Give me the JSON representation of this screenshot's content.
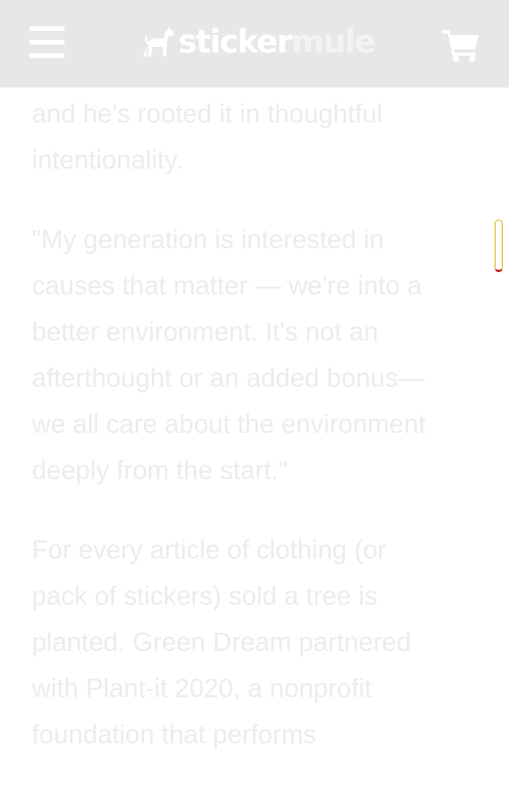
{
  "header": {
    "menu_icon": "hamburger-menu-icon",
    "logo_icon": "mule-icon",
    "logo_text_part1": "sticker",
    "logo_text_part2": "mule",
    "cart_icon": "shopping-cart-icon",
    "background_color": "#e7e7e7"
  },
  "article": {
    "paragraphs": [
      "and he's rooted it in thoughtful\nintentionality.",
      "\"My generation is interested in\ncauses that matter — we're into a\nbetter environment. It's not an\nafterthought or an added bonus—\nwe all care about the environment\ndeeply from the start.\"",
      "For every article of clothing (or\npack of stickers) sold a tree is\nplanted. Green Dream partnered\nwith Plant-it 2020, a nonprofit\nfoundation that performs"
    ],
    "text_color": "#ececec"
  }
}
